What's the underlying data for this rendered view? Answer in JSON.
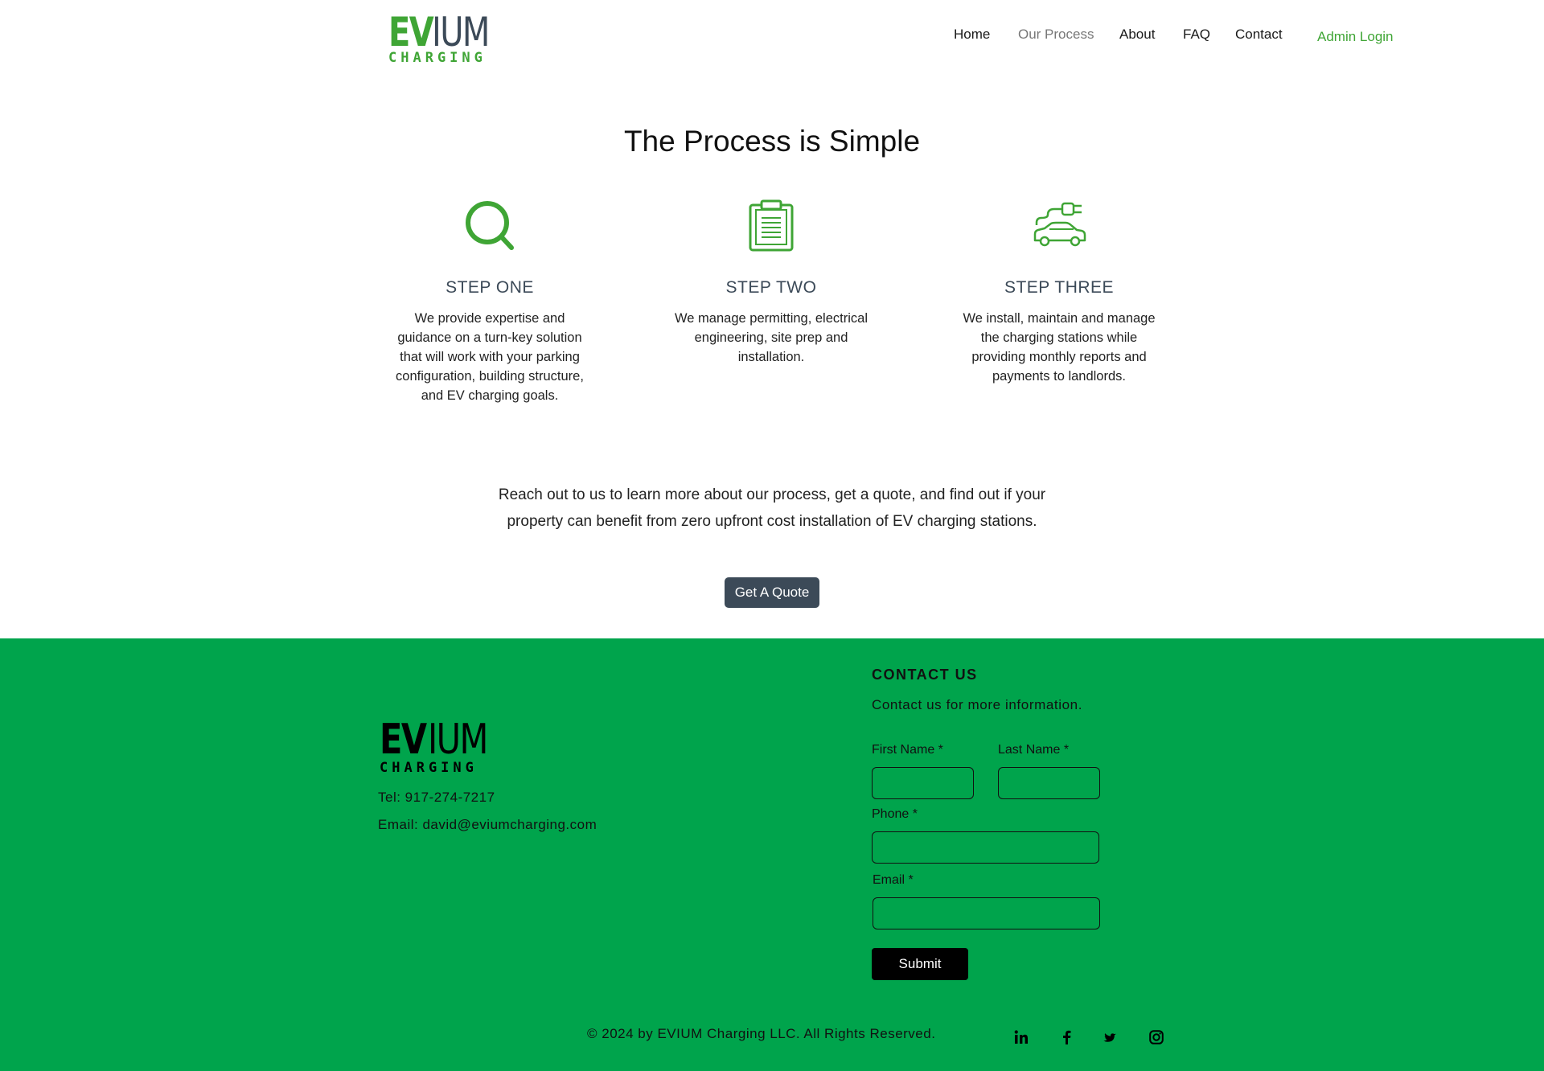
{
  "header": {
    "logo": {
      "ev": "EV",
      "ium": "IUM",
      "charging": "CHARGING"
    },
    "nav": [
      {
        "label": "Home"
      },
      {
        "label": "Our Process"
      },
      {
        "label": "About"
      },
      {
        "label": "FAQ"
      },
      {
        "label": "Contact"
      }
    ],
    "admin_login": "Admin Login"
  },
  "main": {
    "title": "The Process is Simple",
    "steps": [
      {
        "title": "STEP ONE",
        "text": "We provide expertise and guidance on a turn-key solution that will work with your parking configuration, building structure, and EV charging goals.",
        "icon": "search-icon"
      },
      {
        "title": "STEP TWO",
        "text": "We manage permitting, electrical engineering, site prep and installation.",
        "icon": "clipboard-icon"
      },
      {
        "title": "STEP THREE",
        "text": "We install, maintain and manage the charging stations while providing monthly reports and payments to landlords.",
        "icon": "ev-car-plug-icon"
      }
    ],
    "reach_text": "Reach out to us to learn more about our process, get a quote, and find out if your property can benefit from zero upfront cost installation of EV charging stations.",
    "quote_button": "Get A Quote"
  },
  "footer": {
    "logo": {
      "ev": "EV",
      "ium": "IUM",
      "charging": "CHARGING"
    },
    "tel": "Tel: 917-274-7217",
    "email": "Email: david@eviumcharging.com",
    "contact_title": "CONTACT US",
    "contact_sub": "Contact us for more information.",
    "form": {
      "first_name_label": "First Name *",
      "last_name_label": "Last Name *",
      "phone_label": "Phone *",
      "email_label": "Email *",
      "first_name_value": "",
      "last_name_value": "",
      "phone_value": "",
      "email_value": "",
      "submit_label": "Submit"
    },
    "copyright": "© 2024 by EVIUM Charging LLC. All Rights Reserved.",
    "social": [
      "linkedin-icon",
      "facebook-icon",
      "twitter-icon",
      "instagram-icon"
    ]
  },
  "colors": {
    "brand_green": "#3fa535",
    "footer_green": "#00a44c",
    "slate": "#3c4a58"
  }
}
